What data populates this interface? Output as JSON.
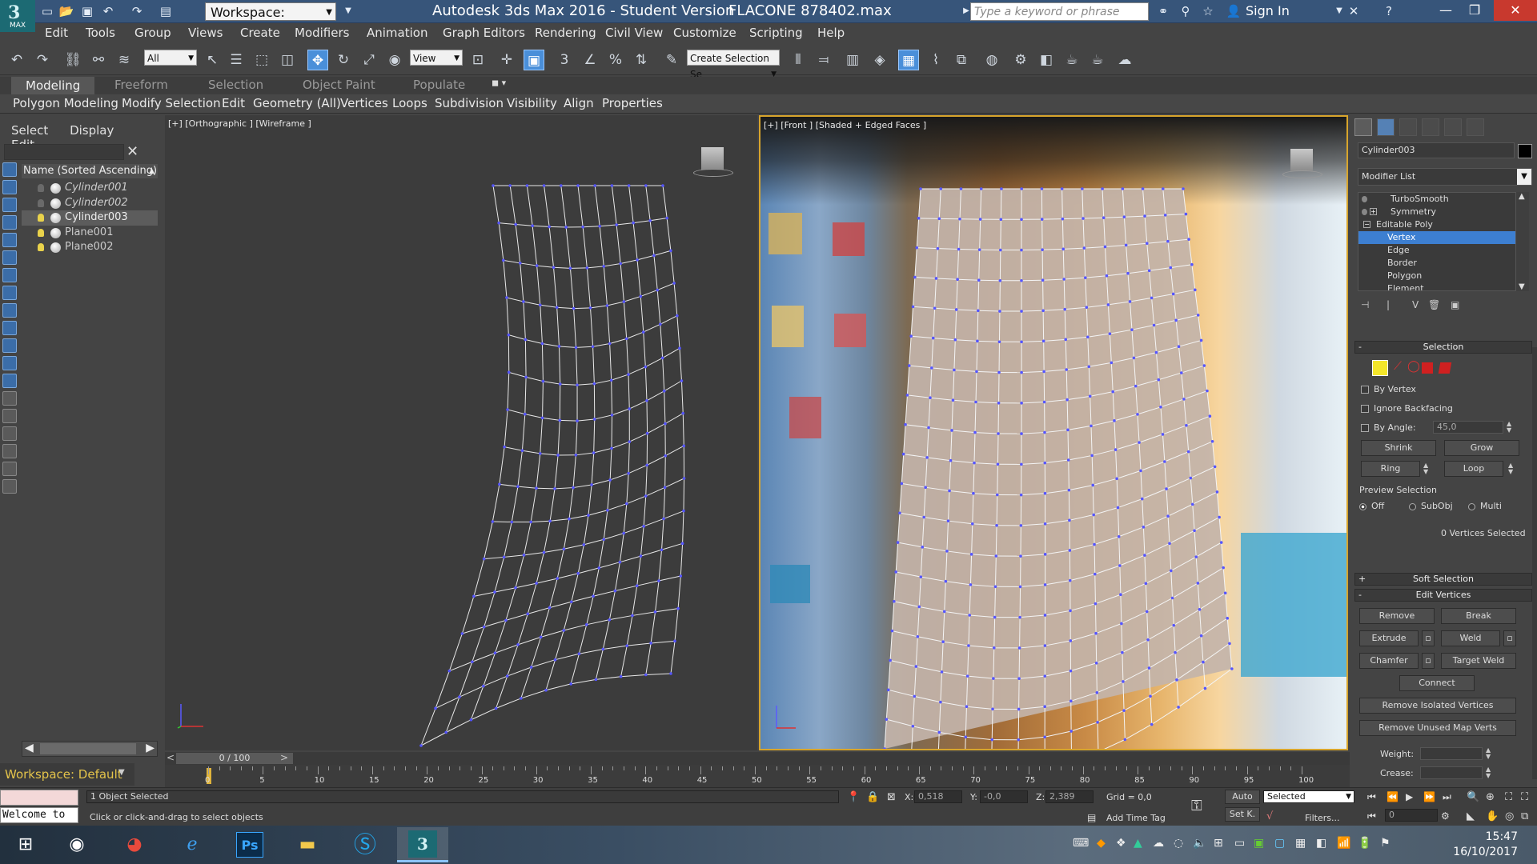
{
  "titlebar": {
    "workspace": "Workspace: Default",
    "app_title": "Autodesk 3ds Max 2016 - Student Version",
    "file_title": "FLACONE 878402.max",
    "search_placeholder": "Type a keyword or phrase",
    "signin": "Sign In",
    "logo_text": "MAX"
  },
  "menu": [
    "Edit",
    "Tools",
    "Group",
    "Views",
    "Create",
    "Modifiers",
    "Animation",
    "Graph Editors",
    "Rendering",
    "Civil View",
    "Customize",
    "Scripting",
    "Help"
  ],
  "toolbar": {
    "filter_select": "All",
    "refcoord_select": "View",
    "named_selection": "Create Selection Se"
  },
  "ribbon": {
    "tabs": [
      "Modeling",
      "Freeform",
      "Selection",
      "Object Paint",
      "Populate"
    ],
    "active_tab": "Modeling",
    "panels": [
      "Polygon Modeling",
      "Modify Selection",
      "Edit",
      "Geometry (All)",
      "Vertices",
      "Loops",
      "Subdivision",
      "Visibility",
      "Align",
      "Properties"
    ]
  },
  "explorer": {
    "tabs": [
      "Select",
      "Display",
      "Edit"
    ],
    "header": "Name (Sorted Ascending)",
    "objects": [
      {
        "name": "Cylinder001",
        "italic": true,
        "light": false
      },
      {
        "name": "Cylinder002",
        "italic": true,
        "light": false
      },
      {
        "name": "Cylinder003",
        "italic": false,
        "light": true,
        "selected": true
      },
      {
        "name": "Plane001",
        "italic": false,
        "light": true
      },
      {
        "name": "Plane002",
        "italic": false,
        "light": true
      }
    ]
  },
  "viewports": {
    "left_label": "[+] [Orthographic ] [Wireframe ]",
    "right_label": "[+] [Front ] [Shaded + Edged Faces ]",
    "viewcube_text": "FRONT"
  },
  "timeline": {
    "frame_label": "0 / 100",
    "ticks": [
      "0",
      "5",
      "10",
      "15",
      "20",
      "25",
      "30",
      "35",
      "40",
      "45",
      "50",
      "55",
      "60",
      "65",
      "70",
      "75",
      "80",
      "85",
      "90",
      "95",
      "100"
    ]
  },
  "status": {
    "workspace": "Workspace: Default",
    "maxscript": "Welcome to",
    "selection": "1 Object Selected",
    "prompt": "Click or click-and-drag to select objects",
    "x": "0,518",
    "y": "-0,0",
    "z": "2,389",
    "x_label": "X:",
    "y_label": "Y:",
    "z_label": "Z:",
    "grid": "Grid = 0,0",
    "add_time_tag": "Add Time Tag",
    "auto": "Auto",
    "setk": "Set K.",
    "key_mode": "Selected",
    "filters": "Filters...",
    "frame": "0"
  },
  "command_panel": {
    "object_name": "Cylinder003",
    "modifier_list": "Modifier List",
    "stack": [
      {
        "label": "TurboSmooth",
        "type": "modifier"
      },
      {
        "label": "Symmetry",
        "type": "modifier"
      },
      {
        "label": "Editable Poly",
        "type": "base"
      },
      {
        "label": "Vertex",
        "type": "sub",
        "selected": true
      },
      {
        "label": "Edge",
        "type": "sub"
      },
      {
        "label": "Border",
        "type": "sub"
      },
      {
        "label": "Polygon",
        "type": "sub"
      },
      {
        "label": "Element",
        "type": "sub"
      }
    ],
    "selection_title": "Selection",
    "by_vertex": "By Vertex",
    "ignore_backfacing": "Ignore Backfacing",
    "by_angle": "By Angle:",
    "angle_value": "45,0",
    "shrink": "Shrink",
    "grow": "Grow",
    "ring": "Ring",
    "loop": "Loop",
    "preview_selection": "Preview Selection",
    "preview_options": [
      "Off",
      "SubObj",
      "Multi"
    ],
    "vertices_selected": "0 Vertices Selected",
    "soft_selection": "Soft Selection",
    "edit_vertices": "Edit Vertices",
    "buttons": {
      "remove": "Remove",
      "break": "Break",
      "extrude": "Extrude",
      "weld": "Weld",
      "chamfer": "Chamfer",
      "target_weld": "Target Weld",
      "connect": "Connect",
      "remove_isolated": "Remove Isolated Vertices",
      "remove_unused": "Remove Unused Map Verts"
    },
    "weight_label": "Weight:",
    "crease_label": "Crease:"
  },
  "taskbar": {
    "time": "15:47",
    "date": "16/10/2017"
  },
  "colors": {
    "titlebar": "#37557a",
    "selection_blue": "#3d7fd1",
    "active_viewport_border": "#d8a52c",
    "vertex_marker": "#5555ff",
    "workspace_text": "#e3c34a"
  }
}
